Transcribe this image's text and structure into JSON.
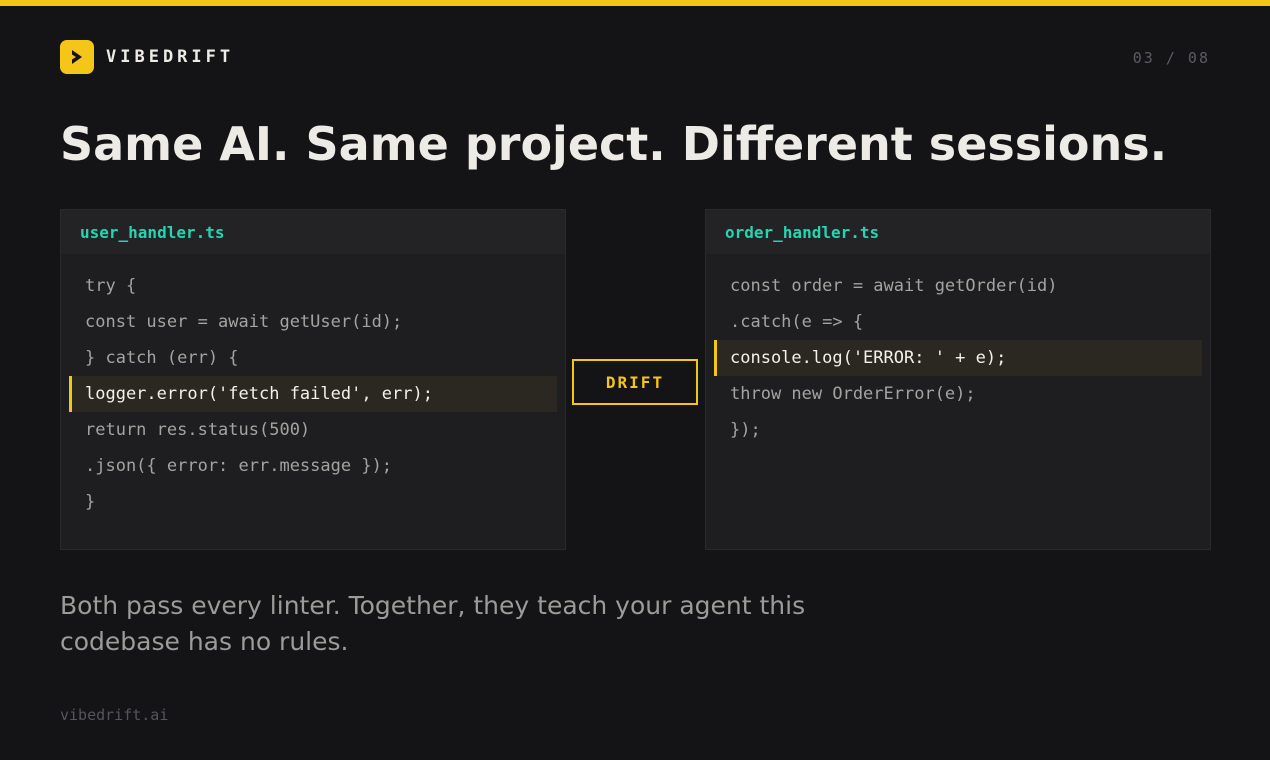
{
  "colors": {
    "accent": "#f5c518",
    "background": "#141416",
    "filename": "#27d3b0",
    "highlight_bg": "#2a2820"
  },
  "brand": {
    "logo_icon": "chevron-right-icon",
    "name": "VIBEDRIFT"
  },
  "page_counter": "03 / 08",
  "headline": "Same AI. Same project. Different sessions.",
  "left_panel": {
    "filename": "user_handler.ts",
    "lines": [
      {
        "text": "try {",
        "highlighted": false
      },
      {
        "text": "const user = await getUser(id);",
        "highlighted": false
      },
      {
        "text": "} catch (err) {",
        "highlighted": false
      },
      {
        "text": "logger.error('fetch failed', err);",
        "highlighted": true
      },
      {
        "text": "return res.status(500)",
        "highlighted": false
      },
      {
        "text": ".json({ error: err.message });",
        "highlighted": false
      },
      {
        "text": "}",
        "highlighted": false
      }
    ]
  },
  "drift_label": "DRIFT",
  "right_panel": {
    "filename": "order_handler.ts",
    "lines": [
      {
        "text": "const order = await getOrder(id)",
        "highlighted": false
      },
      {
        "text": ".catch(e => {",
        "highlighted": false
      },
      {
        "text": "console.log('ERROR: ' + e);",
        "highlighted": true
      },
      {
        "text": "throw new OrderError(e);",
        "highlighted": false
      },
      {
        "text": "});",
        "highlighted": false
      }
    ]
  },
  "caption": "Both pass every linter. Together, they teach your agent this codebase has no rules.",
  "footer": "vibedrift.ai"
}
